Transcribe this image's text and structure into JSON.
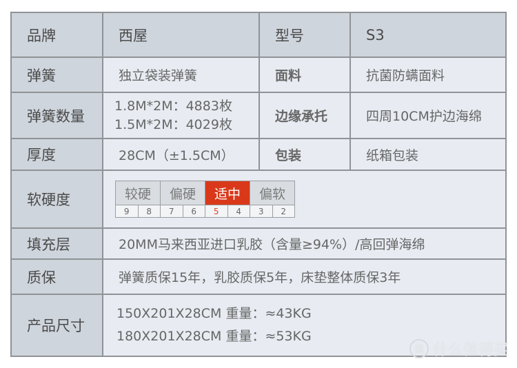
{
  "rows": {
    "brand": {
      "label": "品牌",
      "value": "西屋",
      "label2": "型号",
      "value2": "S3"
    },
    "spring": {
      "label": "弹簧",
      "value": "独立袋装弹簧",
      "label2": "面料",
      "value2": "抗菌防螨面料"
    },
    "spring_count": {
      "label": "弹簧数量",
      "values": [
        "1.8M*2M：4883枚",
        "1.5M*2M：4029枚"
      ],
      "label2": "边缘承托",
      "value2": "四周10CM护边海绵"
    },
    "thickness": {
      "label": "厚度",
      "value": "28CM（±1.5CM）",
      "label2": "包装",
      "value2": "纸箱包装"
    },
    "firmness": {
      "label": "软硬度",
      "grades": [
        {
          "label": "较硬",
          "active": false
        },
        {
          "label": "偏硬",
          "active": false
        },
        {
          "label": "适中",
          "active": true
        },
        {
          "label": "偏软",
          "active": false
        }
      ],
      "numbers": [
        "9",
        "8",
        "7",
        "6",
        "5",
        "4",
        "3",
        "2"
      ],
      "selected_number": "5"
    },
    "filling": {
      "label": "填充层",
      "value": "20MM马来西亚进口乳胶（含量≥94%）/高回弹海绵"
    },
    "warranty": {
      "label": "质保",
      "value": "弹簧质保15年，乳胶质保5年，床垫整体质保3年"
    },
    "size": {
      "label": "产品尺寸",
      "values": [
        "150X201X28CM  重量：≈43KG",
        "180X201X28CM  重量：≈53KG"
      ]
    }
  },
  "watermark": {
    "icon_text": "值",
    "text": "什么值得买"
  },
  "colors": {
    "label_bg": "#cfd5dc",
    "value_bg": "#e8ecf2",
    "active": "#d9391a",
    "border": "#8f9296"
  }
}
